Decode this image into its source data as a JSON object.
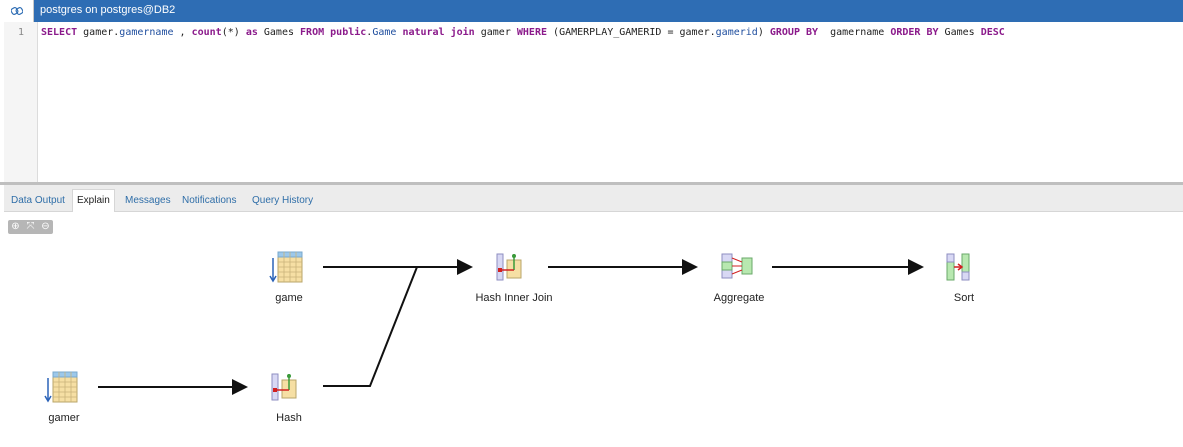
{
  "window": {
    "title": "postgres on postgres@DB2",
    "icon": "connection-icon",
    "accent_color": "#2e6db4"
  },
  "editor": {
    "line_number": "1",
    "sql_text": "SELECT gamer.gamername , count(*) as Games FROM public.Game natural join gamer WHERE (GAMERPLAY_GAMERID = gamer.gamerid) GROUP BY  gamername ORDER BY Games DESC"
  },
  "tabs": [
    {
      "label": "Data Output",
      "active": false
    },
    {
      "label": "Explain",
      "active": true
    },
    {
      "label": "Messages",
      "active": false
    },
    {
      "label": "Notifications",
      "active": false
    },
    {
      "label": "Query History",
      "active": false
    }
  ],
  "zoom_controls": [
    {
      "icon": "zoom-in-icon",
      "glyph": "⊕"
    },
    {
      "icon": "zoom-fit-icon",
      "glyph": "⤧"
    },
    {
      "icon": "zoom-out-icon",
      "glyph": "⊖"
    }
  ],
  "plan": {
    "nodes": [
      {
        "id": "game",
        "label": "game",
        "icon": "seq-scan-icon"
      },
      {
        "id": "gamer",
        "label": "gamer",
        "icon": "seq-scan-icon"
      },
      {
        "id": "hash",
        "label": "Hash",
        "icon": "hash-icon"
      },
      {
        "id": "hash_join",
        "label": "Hash Inner Join",
        "icon": "hash-join-icon"
      },
      {
        "id": "aggregate",
        "label": "Aggregate",
        "icon": "aggregate-icon"
      },
      {
        "id": "sort",
        "label": "Sort",
        "icon": "sort-icon"
      }
    ]
  }
}
